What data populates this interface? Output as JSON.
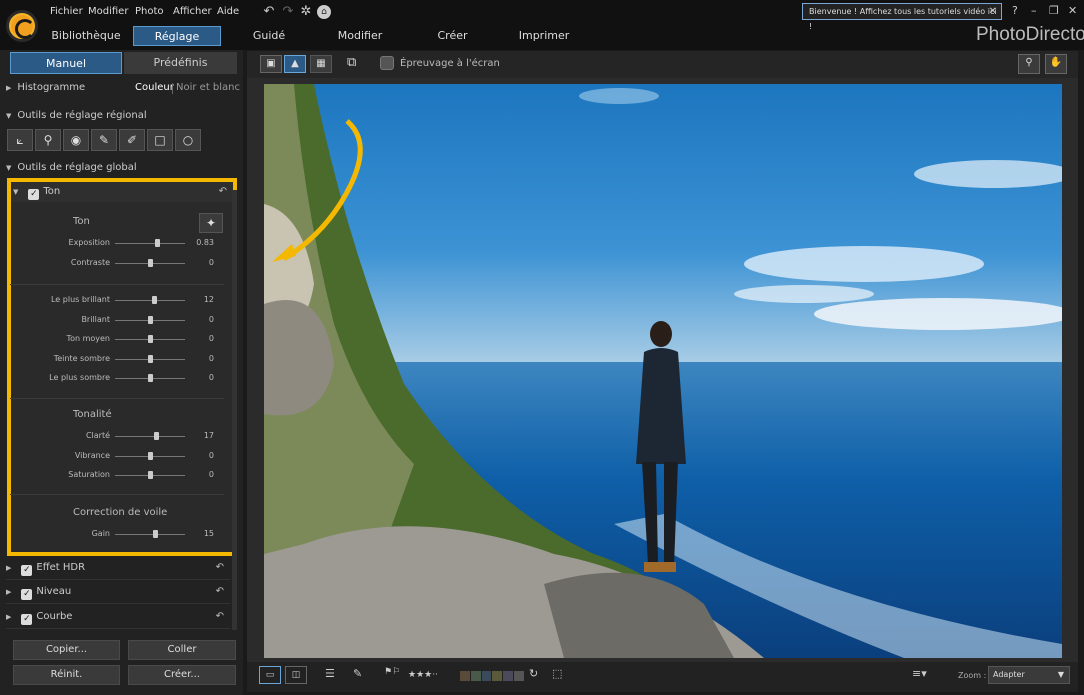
{
  "menu": [
    "Fichier",
    "Modifier",
    "Photo",
    "Afficher",
    "Aide"
  ],
  "nav": [
    "Bibliothèque",
    "Réglage",
    "Guidé",
    "Modifier",
    "Créer",
    "Imprimer"
  ],
  "brand": "PhotoDirector",
  "tip": "Bienvenue ! Affichez tous les tutoriels vidéo ici !",
  "tabs": {
    "manual": "Manuel",
    "presets": "Prédéfinis"
  },
  "histogram": {
    "label": "Histogramme",
    "color": "Couleur",
    "bw": "Noir et blanc"
  },
  "regional": {
    "label": "Outils de réglage régional"
  },
  "global": {
    "label": "Outils de réglage global"
  },
  "tone_group": {
    "label": "Ton",
    "section_ton": "Ton",
    "sliders_a": [
      {
        "label": "Exposition",
        "value": "0.83",
        "pos": 0.6
      },
      {
        "label": "Contraste",
        "value": "0",
        "pos": 0.5
      }
    ],
    "sliders_b": [
      {
        "label": "Le plus brillant",
        "value": "12",
        "pos": 0.56
      },
      {
        "label": "Brillant",
        "value": "0",
        "pos": 0.5
      },
      {
        "label": "Ton moyen",
        "value": "0",
        "pos": 0.5
      },
      {
        "label": "Teinte sombre",
        "value": "0",
        "pos": 0.5
      },
      {
        "label": "Le plus sombre",
        "value": "0",
        "pos": 0.5
      }
    ],
    "section_tonalite": "Tonalité",
    "sliders_c": [
      {
        "label": "Clarté",
        "value": "17",
        "pos": 0.58
      },
      {
        "label": "Vibrance",
        "value": "0",
        "pos": 0.5
      },
      {
        "label": "Saturation",
        "value": "0",
        "pos": 0.5
      }
    ],
    "section_voile": "Correction de voile",
    "sliders_d": [
      {
        "label": "Gain",
        "value": "15",
        "pos": 0.57
      }
    ]
  },
  "groups": [
    "Effet HDR",
    "Niveau",
    "Courbe"
  ],
  "buttons": {
    "copy": "Copier...",
    "paste": "Coller",
    "reset": "Réinit.",
    "create": "Créer..."
  },
  "toolbar": {
    "proof": "Épreuvage à l'écran"
  },
  "bottom": {
    "zoom_label": "Zoom :",
    "zoom_value": "Adapter"
  },
  "colors": {
    "accent": "#2b5a86",
    "highlight": "#f5b800"
  }
}
